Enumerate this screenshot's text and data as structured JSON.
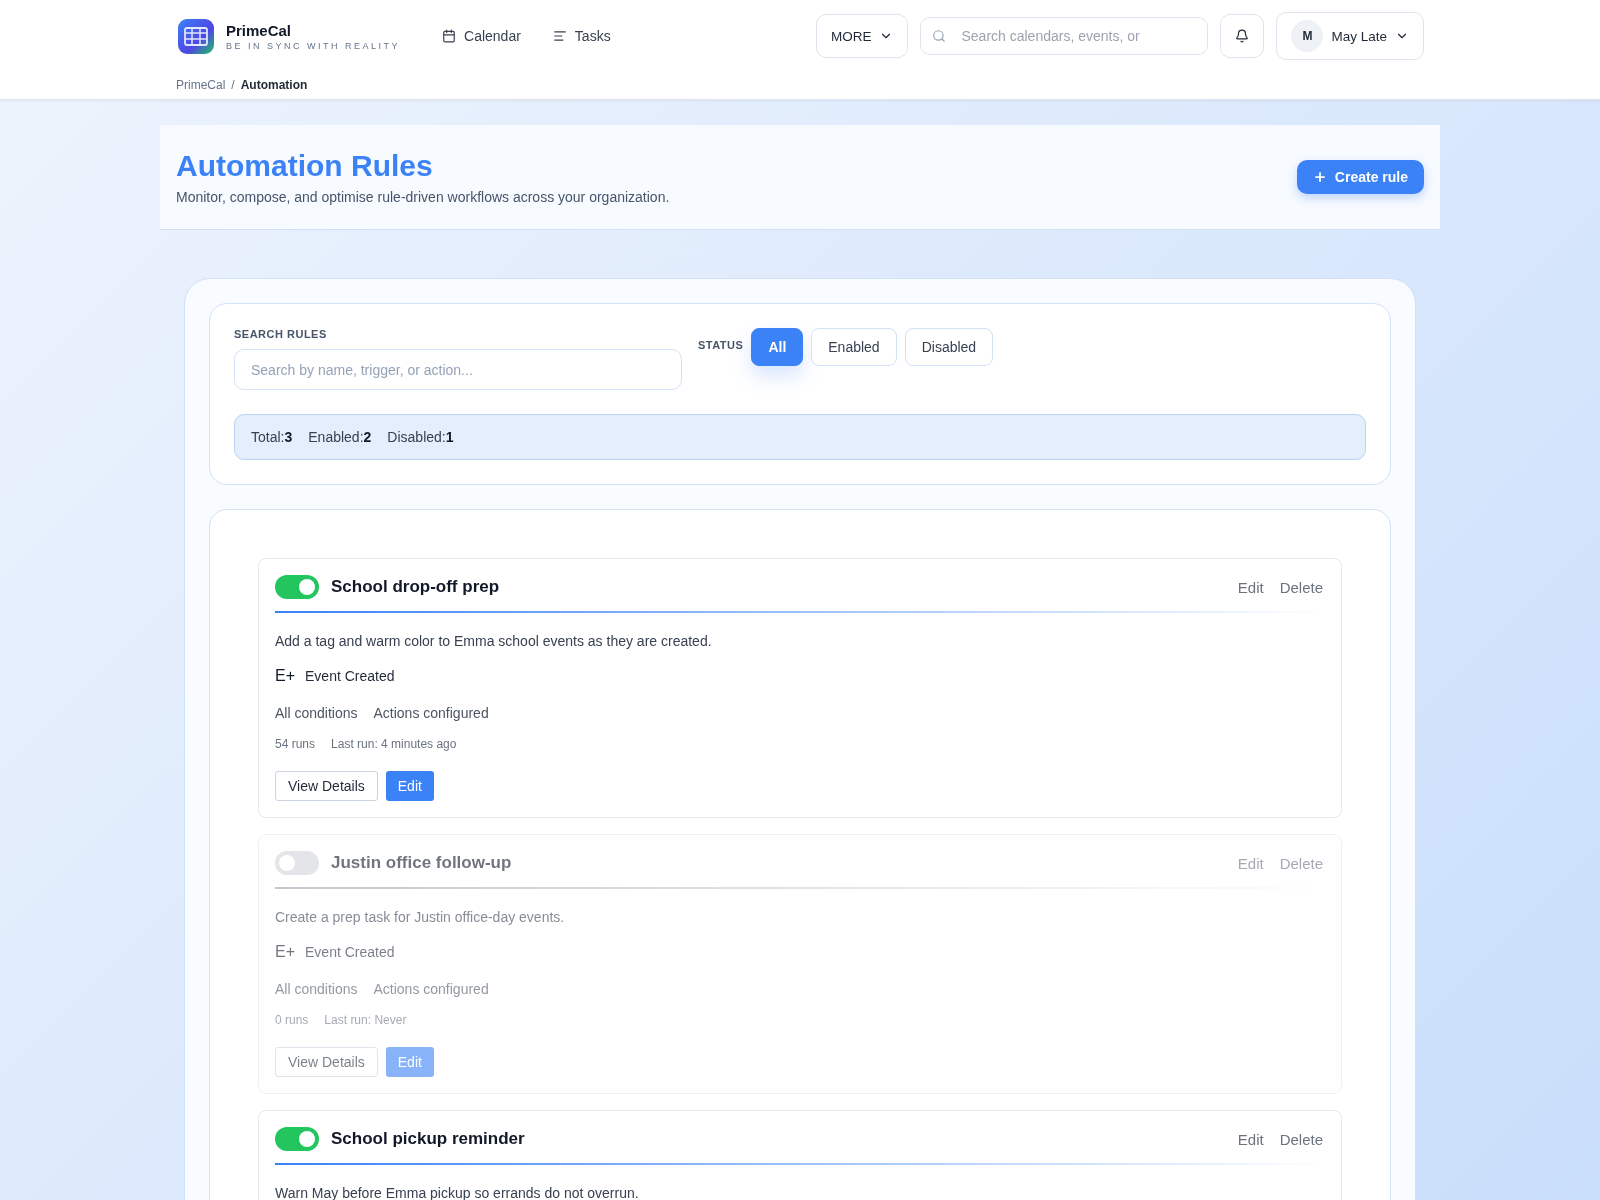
{
  "app": {
    "name": "PrimeCal",
    "tagline": "BE IN SYNC WITH REALITY"
  },
  "nav": [
    {
      "kind": "calendar",
      "label": "Calendar"
    },
    {
      "kind": "tasks",
      "label": "Tasks"
    }
  ],
  "more_menu": "MORE",
  "search": {
    "placeholder": "Search calendars, events, or"
  },
  "user": {
    "initial": "M",
    "name": "May Late"
  },
  "breadcrumb": {
    "items": [
      "PrimeCal",
      "Automation"
    ],
    "separator": "/"
  },
  "page": {
    "title": "Automation Rules",
    "subtitle": "Monitor, compose, and optimise rule-driven workflows across your organization.",
    "create_button": "Create rule"
  },
  "filters": {
    "search_label": "SEARCH RULES",
    "search_placeholder": "Search by name, trigger, or action...",
    "status_label": "STATUS",
    "status_options": [
      {
        "label": "All",
        "selected": true
      },
      {
        "label": "Enabled",
        "selected": false
      },
      {
        "label": "Disabled",
        "selected": false
      }
    ],
    "stats": [
      "Total:**3**",
      "Enabled:**2**",
      "Disabled:**1**"
    ]
  },
  "rules": [
    {
      "name": "School drop-off prep",
      "on": true,
      "edit": "Edit",
      "delete": "Delete",
      "description": "Add a tag and warm color to Emma school events as they are created.",
      "trigger_icon": "E+",
      "trigger": "Event Created",
      "conditions": "All conditions",
      "actions": "Actions configured",
      "runs": "54 runs",
      "last_run": "Last run: 4 minutes ago",
      "details_button": "View Details",
      "edit_button": "Edit"
    },
    {
      "name": "Justin office follow-up",
      "on": false,
      "edit": "Edit",
      "delete": "Delete",
      "description": "Create a prep task for Justin office-day events.",
      "trigger_icon": "E+",
      "trigger": "Event Created",
      "conditions": "All conditions",
      "actions": "Actions configured",
      "runs": "0 runs",
      "last_run": "Last run: Never",
      "details_button": "View Details",
      "edit_button": "Edit"
    },
    {
      "name": "School pickup reminder",
      "on": true,
      "edit": "Edit",
      "delete": "Delete",
      "description": "Warn May before Emma pickup so errands do not overrun."
    }
  ]
}
